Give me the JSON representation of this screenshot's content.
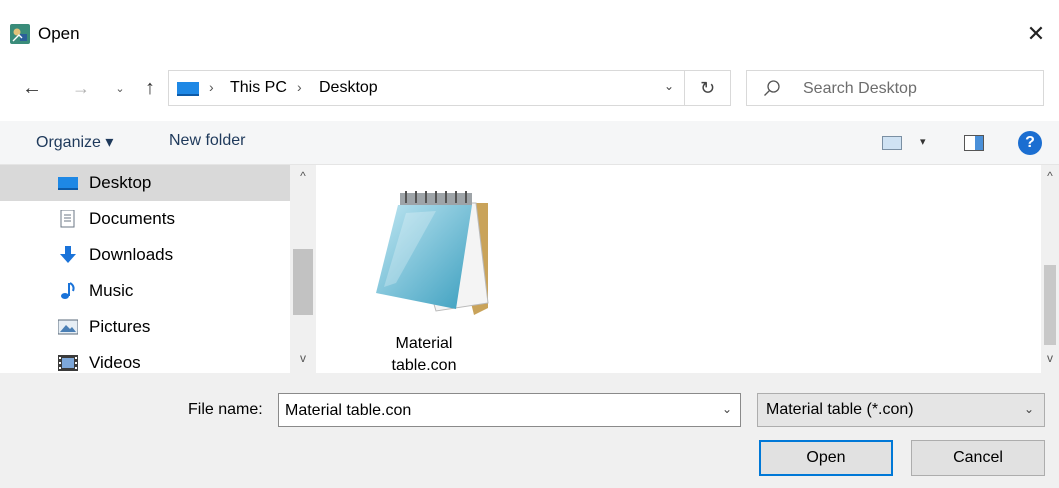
{
  "window": {
    "title": "Open",
    "close_glyph": "✕"
  },
  "nav": {
    "back_glyph": "←",
    "forward_glyph": "→",
    "recent_glyph": "⌄",
    "up_glyph": "↑"
  },
  "address": {
    "parts": [
      "This PC",
      "Desktop"
    ],
    "separator": "›",
    "dropdown_glyph": "⌄",
    "refresh_glyph": "↻"
  },
  "search": {
    "placeholder": "Search Desktop",
    "value": ""
  },
  "toolbar": {
    "organize_label": "Organize ▾",
    "new_folder_label": "New folder",
    "view_dropdown_glyph": "▾",
    "help_label": "?"
  },
  "nav_pane": {
    "items": [
      {
        "label": "Desktop",
        "icon": "desktop-icon",
        "selected": true
      },
      {
        "label": "Documents",
        "icon": "documents-icon",
        "selected": false
      },
      {
        "label": "Downloads",
        "icon": "downloads-icon",
        "selected": false
      },
      {
        "label": "Music",
        "icon": "music-icon",
        "selected": false
      },
      {
        "label": "Pictures",
        "icon": "pictures-icon",
        "selected": false
      },
      {
        "label": "Videos",
        "icon": "videos-icon",
        "selected": false
      }
    ],
    "scroll_up_glyph": "^",
    "scroll_down_glyph": "v"
  },
  "content": {
    "files": [
      {
        "name_line1": "Material",
        "name_line2": "table.con",
        "icon": "notepad-file-icon"
      }
    ],
    "scroll_up_glyph": "^",
    "scroll_down_glyph": "v"
  },
  "bottom": {
    "file_name_label": "File name:",
    "file_name_value": "Material table.con",
    "file_name_dropdown_glyph": "⌄",
    "file_type": "Material table (*.con)",
    "file_type_dropdown_glyph": "⌄",
    "open_label": "Open",
    "cancel_label": "Cancel"
  },
  "colors": {
    "accent": "#0078d7",
    "selection": "#d9d9d9",
    "toolbar_bg": "#f5f6f7",
    "footer_bg": "#f0f0f0",
    "link_text": "#1e395b"
  }
}
